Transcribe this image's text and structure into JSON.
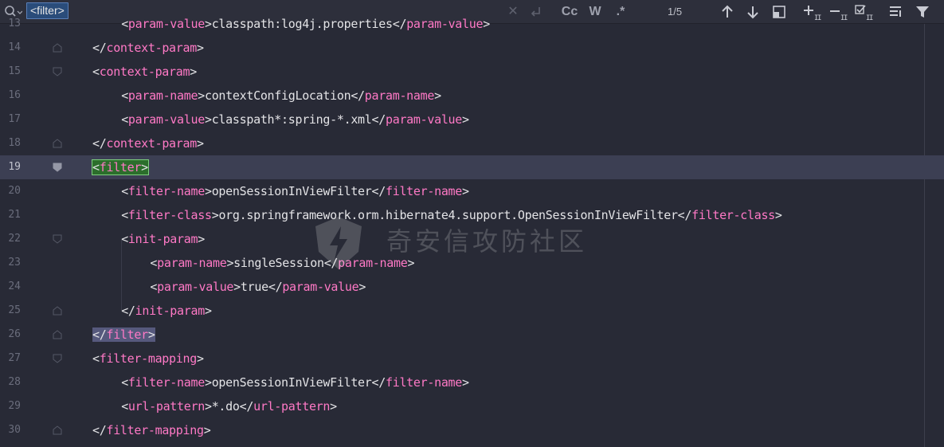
{
  "search": {
    "query": "<filter>",
    "match_case_label": "Cc",
    "words_label": "W",
    "regex_label": ".*",
    "match_count": "1/5"
  },
  "icons": {
    "search": "search-history-icon",
    "clear": "clear-icon",
    "replace": "replace-icon",
    "prev": "arrow-up-icon",
    "next": "arrow-down-icon",
    "in_selection": "in-selection-icon",
    "add_occurrence": "add-occurrence-icon",
    "remove_occurrence": "remove-occurrence-icon",
    "select_all": "select-all-occurrences-icon",
    "context": "context-icon",
    "filter": "filter-icon"
  },
  "colors": {
    "tag": "#ff79c6",
    "text": "#e3e3e6",
    "current_line": "#3c3f53",
    "match_green": "#2c6e2c",
    "match_blue": "#56597d",
    "background": "#282a36"
  },
  "editor": {
    "lines": [
      {
        "num": "13",
        "open": "param-value",
        "text": "classpath:log4j.properties",
        "close": "param-value"
      },
      {
        "num": "14",
        "close_only": "context-param"
      },
      {
        "num": "15",
        "open_only": "context-param"
      },
      {
        "num": "16",
        "open": "param-name",
        "text": "contextConfigLocation",
        "close": "param-name"
      },
      {
        "num": "17",
        "open": "param-value",
        "text": "classpath*:spring-*.xml",
        "close": "param-value"
      },
      {
        "num": "18",
        "close_only": "context-param"
      },
      {
        "num": "19",
        "open_only": "filter"
      },
      {
        "num": "20",
        "open": "filter-name",
        "text": "openSessionInViewFilter",
        "close": "filter-name"
      },
      {
        "num": "21",
        "open": "filter-class",
        "text": "org.springframework.orm.hibernate4.support.OpenSessionInViewFilter",
        "close": "filter-class"
      },
      {
        "num": "22",
        "open_only": "init-param"
      },
      {
        "num": "23",
        "open": "param-name",
        "text": "singleSession",
        "close": "param-name"
      },
      {
        "num": "24",
        "open": "param-value",
        "text": "true",
        "close": "param-value"
      },
      {
        "num": "25",
        "close_only": "init-param"
      },
      {
        "num": "26",
        "close_only": "filter"
      },
      {
        "num": "27",
        "open_only": "filter-mapping"
      },
      {
        "num": "28",
        "open": "filter-name",
        "text": "openSessionInViewFilter",
        "close": "filter-name"
      },
      {
        "num": "29",
        "open": "url-pattern",
        "text": "*.do",
        "close": "url-pattern"
      },
      {
        "num": "30",
        "close_only": "filter-mapping"
      }
    ]
  },
  "watermark": {
    "text": "奇安信攻防社区"
  }
}
